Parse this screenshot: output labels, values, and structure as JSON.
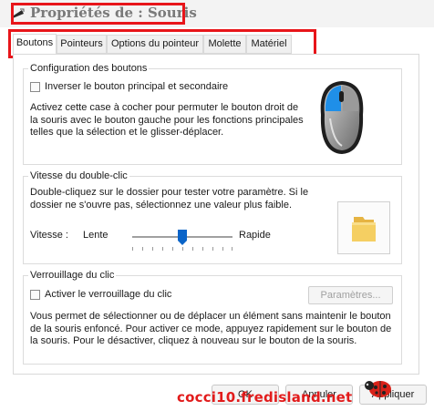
{
  "window": {
    "title": "Propriétés de : Souris"
  },
  "tabs": [
    {
      "label": "Boutons",
      "active": true
    },
    {
      "label": "Pointeurs",
      "active": false
    },
    {
      "label": "Options du pointeur",
      "active": false
    },
    {
      "label": "Molette",
      "active": false
    },
    {
      "label": "Matériel",
      "active": false
    }
  ],
  "button_config": {
    "group_title": "Configuration des boutons",
    "checkbox_label": "Inverser le bouton principal et secondaire",
    "checked": false,
    "description_lines": [
      "Activez cette case à cocher pour permuter le bouton droit de",
      "la souris avec le bouton gauche pour les fonctions principales",
      "telles que la sélection et le glisser-déplacer."
    ]
  },
  "double_click": {
    "group_title": "Vitesse du double-clic",
    "description_lines": [
      "Double-cliquez sur le dossier pour tester votre paramètre. Si le",
      "dossier ne s'ouvre pas, sélectionnez une valeur plus faible."
    ],
    "speed_label": "Vitesse :",
    "slow_label": "Lente",
    "fast_label": "Rapide",
    "slider_position": 0.5
  },
  "click_lock": {
    "group_title": "Verrouillage du clic",
    "checkbox_label": "Activer le verrouillage du clic",
    "checked": false,
    "settings_button": "Paramètres...",
    "description_lines": [
      "Vous permet de sélectionner ou de déplacer un élément sans maintenir le bouton",
      "de la souris enfoncé. Pour activer ce mode, appuyez rapidement sur le bouton de",
      "la souris. Pour le désactiver, cliquez à nouveau sur le bouton de la souris."
    ]
  },
  "footer": {
    "ok": "OK",
    "cancel": "Annuler",
    "apply": "Appliquer"
  },
  "watermark": "cocci10.fredisland.net",
  "colors": {
    "highlight": "#e8151a",
    "mouse_button_accent": "#1f8fe8",
    "slider_thumb": "#0a64c8",
    "folder": "#f5cf62"
  }
}
